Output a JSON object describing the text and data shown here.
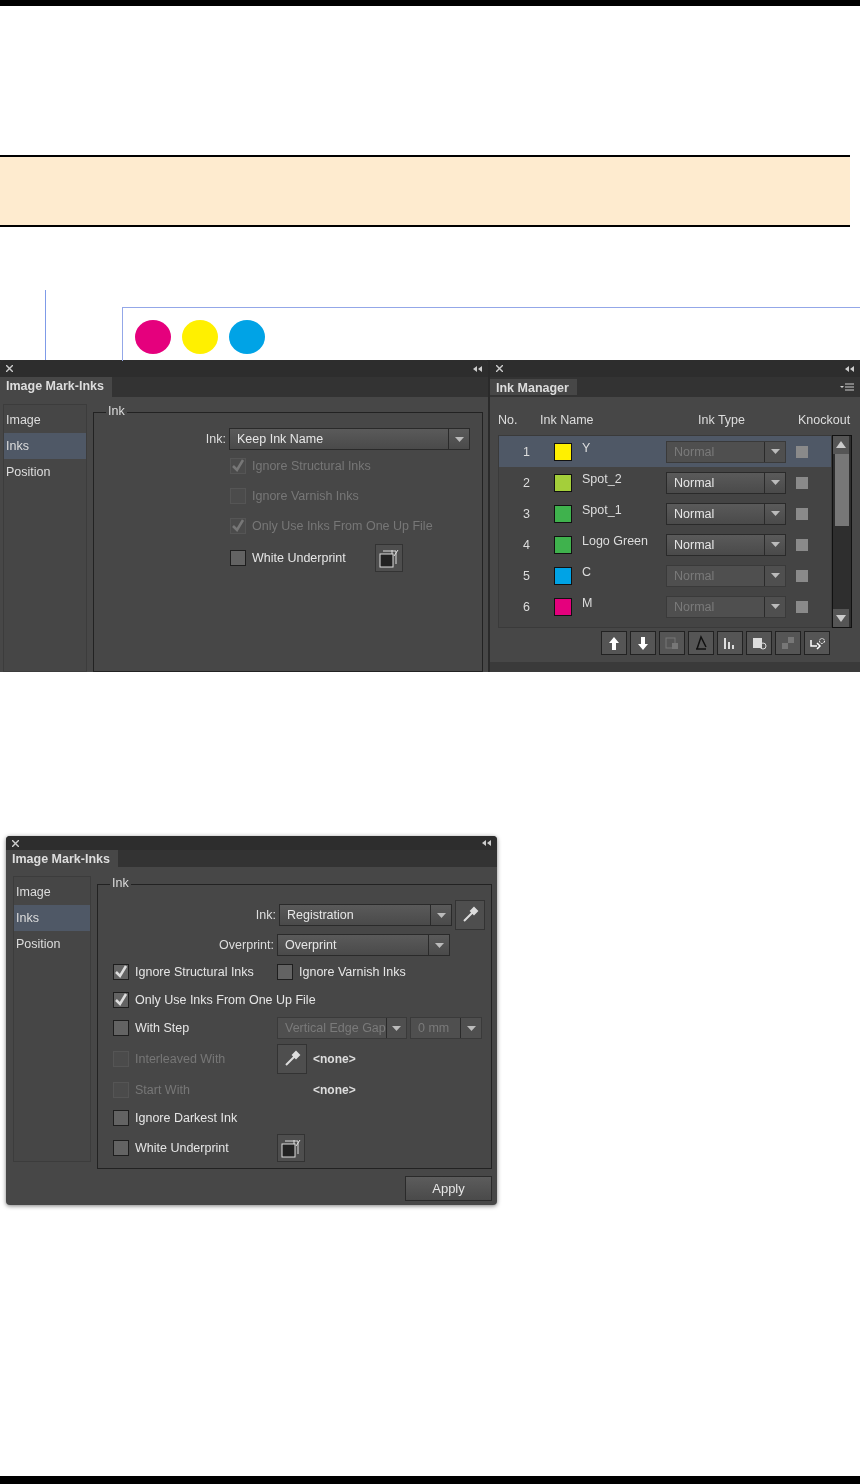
{
  "canvas": {
    "marks": [
      {
        "color": "#e5007d"
      },
      {
        "color": "#fff000"
      },
      {
        "color": "#00a3e6"
      }
    ]
  },
  "panels": [
    {
      "title": "Image Mark-Inks",
      "nav": [
        {
          "label": "Image",
          "selected": false
        },
        {
          "label": "Inks",
          "selected": true
        },
        {
          "label": "Position",
          "selected": false
        }
      ],
      "group": "Ink",
      "fields": [
        {
          "label": "Ink:",
          "value": "Keep Ink Name"
        }
      ],
      "rows": [
        {
          "option": {
            "label": "Ignore Structural Inks",
            "checked": true,
            "disabled": true
          }
        },
        {
          "option": {
            "label": "Ignore Varnish Inks",
            "checked": false,
            "disabled": true
          }
        },
        {
          "option": {
            "label": "Only Use Inks From One Up File",
            "checked": true,
            "disabled": true
          }
        },
        {
          "option": {
            "label": "White Underprint",
            "checked": false,
            "disabled": false
          },
          "controls": [
            {
              "kind": "underprint"
            }
          ]
        }
      ]
    },
    {
      "title": "Image Mark-Inks",
      "nav": [
        {
          "label": "Image",
          "selected": false
        },
        {
          "label": "Inks",
          "selected": true
        },
        {
          "label": "Position",
          "selected": false
        }
      ],
      "group": "Ink",
      "fields": [
        {
          "label": "Ink:",
          "value": "Registration",
          "picker": true
        },
        {
          "label": "Overprint:",
          "value": "Overprint"
        }
      ],
      "rows": [
        {
          "option": {
            "label": "Ignore Structural Inks",
            "checked": true,
            "disabled": false
          },
          "controls": [
            {
              "kind": "check",
              "label": "Ignore Varnish Inks",
              "checked": false,
              "disabled": false
            }
          ]
        },
        {
          "option": {
            "label": "Only Use Inks From One Up File",
            "checked": true,
            "disabled": false
          }
        },
        {
          "option": {
            "label": "With Step",
            "checked": false,
            "disabled": false
          },
          "controls": [
            {
              "kind": "select",
              "value": "Vertical Edge Gap",
              "disabled": true
            },
            {
              "kind": "select",
              "value": "0 mm",
              "disabled": true
            }
          ]
        },
        {
          "option": {
            "label": "Interleaved With",
            "checked": false,
            "disabled": true
          },
          "controls": [
            {
              "kind": "picker"
            },
            {
              "kind": "text",
              "value": "<none>"
            }
          ]
        },
        {
          "option": {
            "label": "Start With",
            "checked": false,
            "disabled": true
          },
          "value": "<none>"
        },
        {
          "option": {
            "label": "Ignore Darkest Ink",
            "checked": false,
            "disabled": false
          }
        },
        {
          "option": {
            "label": "White Underprint",
            "checked": false,
            "disabled": false
          },
          "controls": [
            {
              "kind": "underprint"
            }
          ]
        }
      ],
      "apply": "Apply"
    }
  ],
  "ink_manager": {
    "title": "Ink Manager",
    "columns": [
      "No.",
      "Ink Name",
      "Ink Type",
      "Knockout"
    ],
    "rows": [
      {
        "no": "1",
        "name": "Y",
        "color": "#fff000",
        "type": "Normal",
        "disabled": true,
        "selected": true,
        "knockout": false
      },
      {
        "no": "2",
        "name": "Spot_2",
        "color": "#a4cf3a",
        "type": "Normal",
        "disabled": false,
        "selected": false,
        "knockout": false
      },
      {
        "no": "3",
        "name": "Spot_1",
        "color": "#3fb24d",
        "type": "Normal",
        "disabled": false,
        "selected": false,
        "knockout": false
      },
      {
        "no": "4",
        "name": "Logo Green",
        "color": "#3fb24d",
        "type": "Normal",
        "disabled": false,
        "selected": false,
        "knockout": false
      },
      {
        "no": "5",
        "name": "C",
        "color": "#00a3e6",
        "type": "Normal",
        "disabled": true,
        "selected": false,
        "knockout": false
      },
      {
        "no": "6",
        "name": "M",
        "color": "#e5007d",
        "type": "Normal",
        "disabled": true,
        "selected": false,
        "knockout": false
      }
    ]
  }
}
